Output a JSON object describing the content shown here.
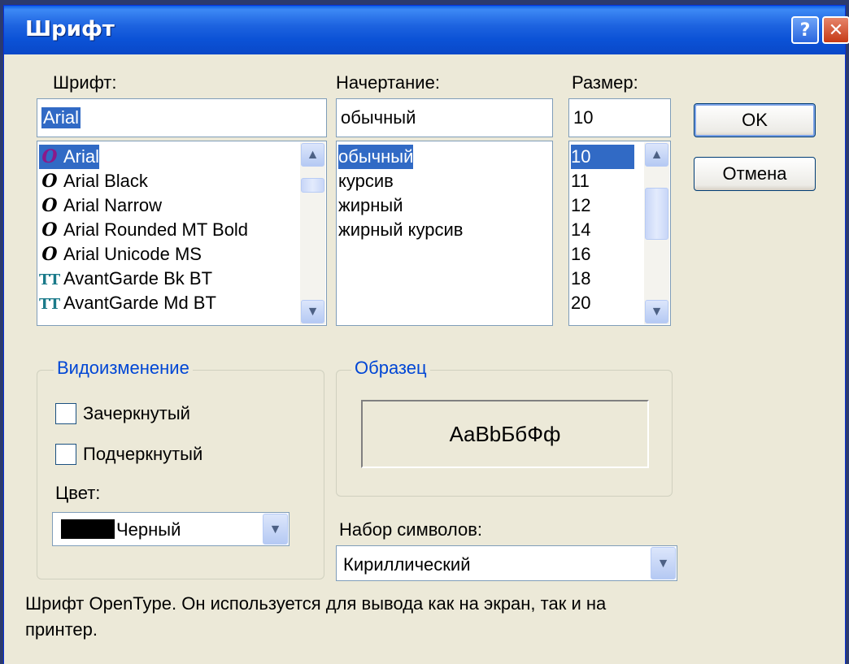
{
  "window": {
    "title": "Шрифт",
    "help_icon": "?",
    "close_icon": "✕"
  },
  "font": {
    "label": "Шрифт:",
    "value": "Arial",
    "items": [
      {
        "label": "Arial",
        "icon": "opentype-icon"
      },
      {
        "label": "Arial Black",
        "icon": "opentype-icon"
      },
      {
        "label": "Arial Narrow",
        "icon": "opentype-icon"
      },
      {
        "label": "Arial Rounded MT Bold",
        "icon": "opentype-icon"
      },
      {
        "label": "Arial Unicode MS",
        "icon": "opentype-icon"
      },
      {
        "label": "AvantGarde Bk BT",
        "icon": "truetype-icon"
      },
      {
        "label": "AvantGarde Md BT",
        "icon": "truetype-icon"
      }
    ],
    "selected_index": 0
  },
  "style": {
    "label": "Начертание:",
    "value": "обычный",
    "items": [
      "обычный",
      "курсив",
      "жирный",
      "жирный курсив"
    ],
    "selected_index": 0
  },
  "size": {
    "label": "Размер:",
    "value": "10",
    "items": [
      "10",
      "11",
      "12",
      "14",
      "16",
      "18",
      "20"
    ],
    "selected_index": 0
  },
  "buttons": {
    "ok": "OK",
    "cancel": "Отмена"
  },
  "effects": {
    "title": "Видоизменение",
    "strikeout": "Зачеркнутый",
    "underline": "Подчеркнутый",
    "color_label": "Цвет:",
    "color_value": "Черный",
    "color_swatch": "#000000"
  },
  "sample": {
    "title": "Образец",
    "text": "AaBbБбФф"
  },
  "charset": {
    "label": "Набор символов:",
    "value": "Кириллический"
  },
  "description": "Шрифт OpenType. Он используется для вывода как на экран, так и на принтер.",
  "colors": {
    "accent": "#316ac5",
    "titlebar": "#0a5fe8",
    "group_title": "#0046d5",
    "dialog_bg": "#ece9d8"
  }
}
